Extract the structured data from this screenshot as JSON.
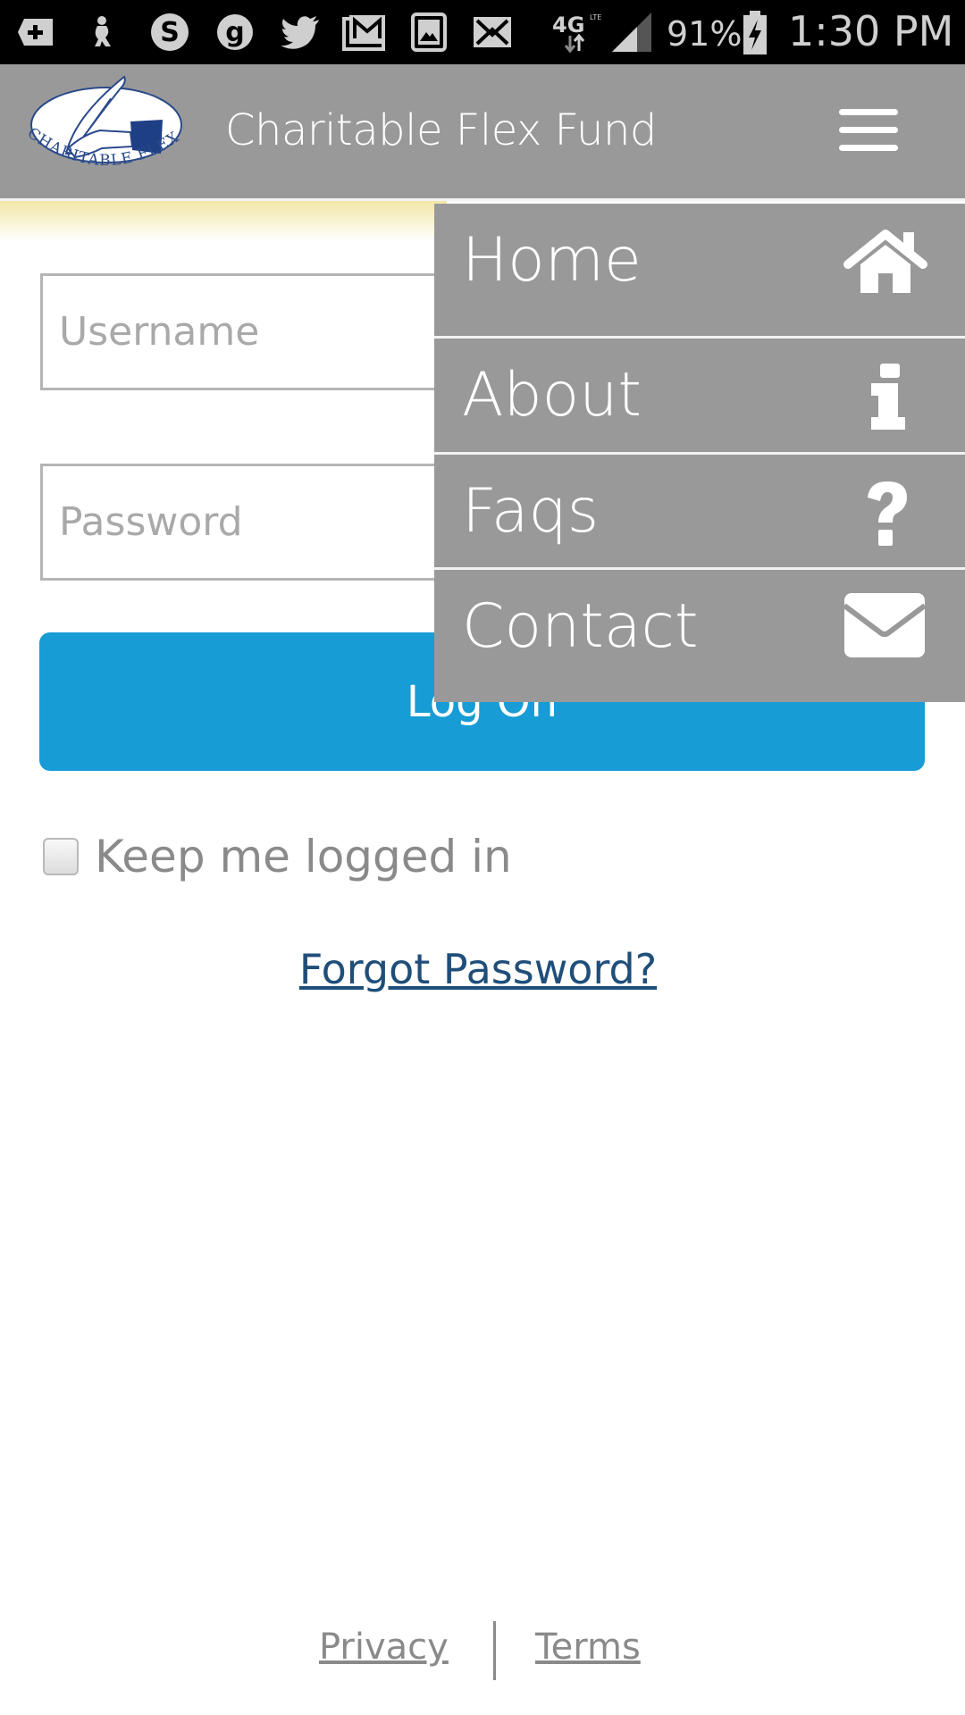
{
  "status_bar": {
    "notification_icons": [
      "add-icon",
      "figure-icon",
      "skype-icon",
      "app-g-icon",
      "twitter-icon",
      "gmail-icon",
      "gallery-icon",
      "email-icon"
    ],
    "network": "4G LTE",
    "battery": "91%",
    "time": "1:30 PM"
  },
  "header": {
    "logo_text": "CHARITABLE FLEX FUND",
    "title": "Charitable Flex Fund",
    "menu_icon": "hamburger-menu-icon"
  },
  "menu": {
    "items": [
      {
        "label": "Home",
        "icon": "home-icon"
      },
      {
        "label": "About",
        "icon": "info-icon"
      },
      {
        "label": "Faqs",
        "icon": "question-icon"
      },
      {
        "label": "Contact",
        "icon": "envelope-icon"
      }
    ]
  },
  "login": {
    "username_placeholder": "Username",
    "username_value": "",
    "password_placeholder": "Password",
    "password_value": "",
    "logon_label": "Log On",
    "remember_label": "Keep me logged in",
    "remember_checked": false,
    "forgot_label": "Forgot Password?"
  },
  "footer": {
    "privacy_label": "Privacy",
    "terms_label": "Terms"
  },
  "colors": {
    "header_bg": "#999999",
    "button_bg": "#179cd5",
    "link": "#1f4e79",
    "logo_navy": "#2a4a8a"
  }
}
